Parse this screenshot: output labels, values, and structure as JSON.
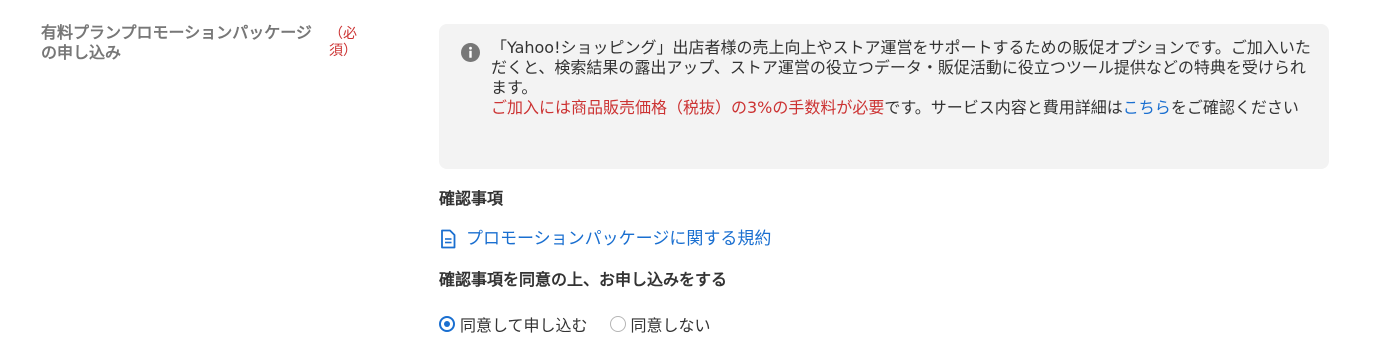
{
  "field": {
    "label": "有料プランプロモーションパッケージの申し込み",
    "required": "（必須）"
  },
  "notice": {
    "icon": "info-icon",
    "line1": "「Yahoo!ショッピング」出店者様の売上向上やストア運営をサポートするための販促オプションです。ご加入いただくと、検索結果の露出アップ、ストア運営の役立つデータ・販促活動に役立つツール提供などの特典を受けられます。",
    "fee_highlight": "ご加入には商品販売価格（税抜）の3%の手数料が必要",
    "fee_suffix": "です。サービス内容と費用詳細は",
    "details_link": "こちら",
    "fee_end": "をご確認ください"
  },
  "confirm": {
    "heading": "確認事項",
    "terms_icon": "document-icon",
    "terms_link": "プロモーションパッケージに関する規約"
  },
  "agreement": {
    "heading": "確認事項を同意の上、お申し込みをする",
    "options": [
      {
        "label": "同意して申し込む",
        "selected": true
      },
      {
        "label": "同意しない",
        "selected": false
      }
    ]
  },
  "colors": {
    "required": "#cc3333",
    "link": "#1a6fd0",
    "notice_bg": "#f3f3f3"
  }
}
